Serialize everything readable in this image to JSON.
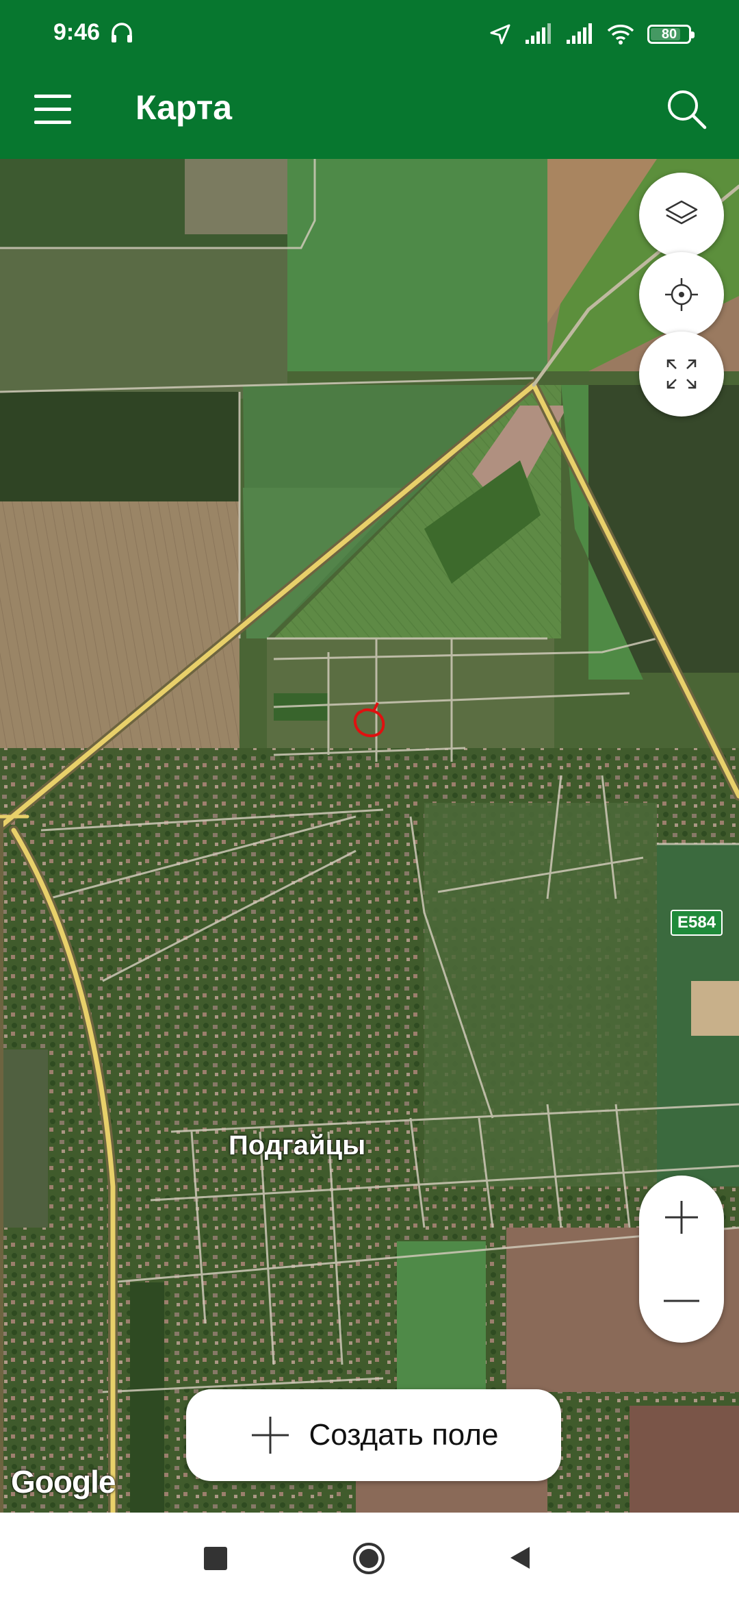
{
  "status_bar": {
    "time": "9:46",
    "battery": "80",
    "battery_level": 0.8
  },
  "app_bar": {
    "title": "Карта"
  },
  "map": {
    "place_label": "Подгайцы",
    "road_badge": "E584",
    "attribution": "Google"
  },
  "controls": {
    "create_field_label": "Создать поле"
  },
  "icons": [
    "headphones-icon",
    "location-arrow-icon",
    "signal-icon",
    "wifi-icon",
    "battery-icon",
    "menu-icon",
    "search-icon",
    "layers-icon",
    "my-location-icon",
    "fullscreen-icon",
    "zoom-in-icon",
    "zoom-out-icon",
    "plus-icon",
    "recent-apps-icon",
    "home-icon",
    "back-icon"
  ],
  "colors": {
    "app_bar": "#07772f",
    "highlight_circle": "#e01010",
    "road": "#e8d06a"
  }
}
